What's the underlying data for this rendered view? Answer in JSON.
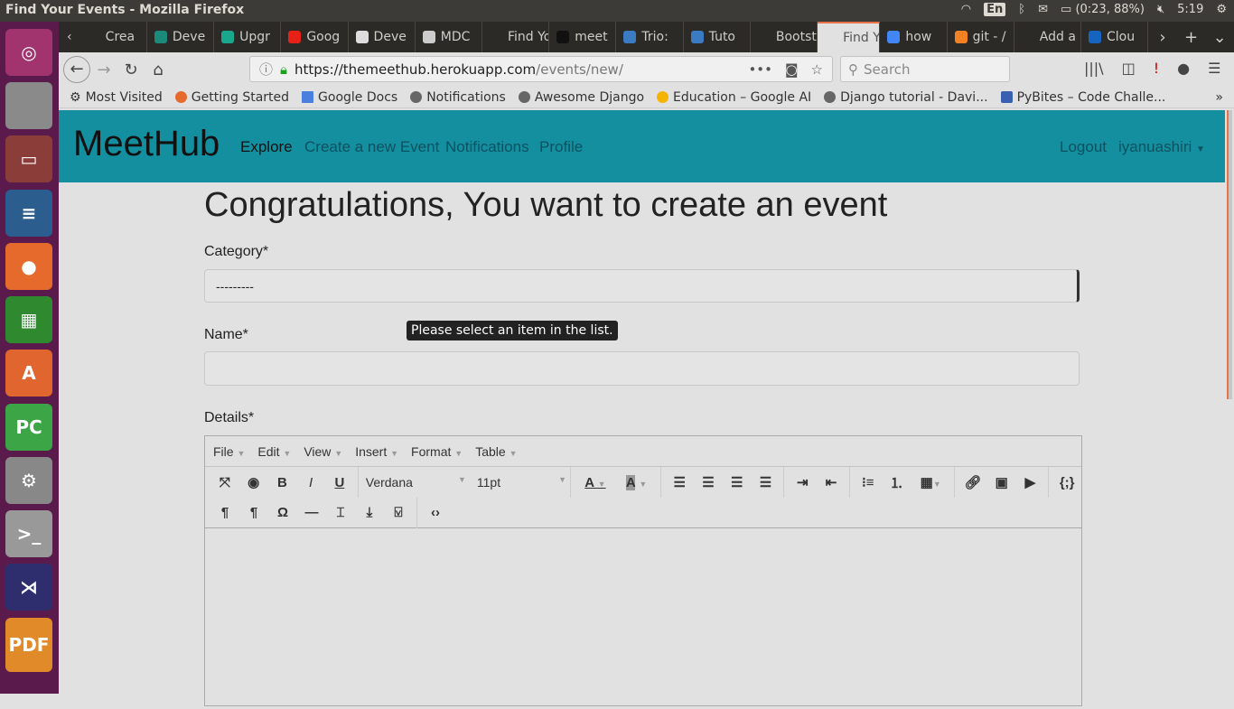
{
  "system": {
    "window_title": "Find Your Events - Mozilla Firefox",
    "keyboard": "En",
    "battery": "(0:23, 88%)",
    "time": "5:19"
  },
  "launcher": [
    "ubuntu-icon",
    "disk-backup-icon",
    "file-manager-icon",
    "writer-icon",
    "firefox-icon",
    "calc-icon",
    "software-center-icon",
    "pycharm-icon",
    "settings-icon",
    "terminal-icon",
    "vscode-icon",
    "pdf-icon"
  ],
  "tabs": [
    {
      "label": "Crea",
      "color": "#2b2a27"
    },
    {
      "label": "Deve",
      "color": "#1a8a7a"
    },
    {
      "label": "Upgr",
      "color": "#1aa88c"
    },
    {
      "label": "Goog",
      "color": "#e62117"
    },
    {
      "label": "Deve",
      "color": "#ddd"
    },
    {
      "label": "MDC",
      "color": "#ccc"
    },
    {
      "label": "Find You",
      "color": "#2b2a27"
    },
    {
      "label": "meet",
      "color": "#111"
    },
    {
      "label": "Trio:",
      "color": "#3b7bc4"
    },
    {
      "label": "Tuto",
      "color": "#3b7bc4"
    },
    {
      "label": "Bootstr",
      "color": "#2b2a27"
    },
    {
      "label": "Find Y",
      "color": "#e1e1e1",
      "active": true
    },
    {
      "label": "how",
      "color": "#4285f4"
    },
    {
      "label": "git - /",
      "color": "#f48024"
    },
    {
      "label": "Add a sc",
      "color": "#2b2a27"
    },
    {
      "label": "Clou",
      "color": "#1565c0"
    }
  ],
  "url": {
    "host": "https://themeethub.herokuapp.com",
    "path": "/events/new/"
  },
  "search_placeholder": "Search",
  "bookmarks": [
    "Most Visited",
    "Getting Started",
    "Google Docs",
    "Notifications",
    "Awesome Django",
    "Education – Google AI",
    "Django tutorial - Davi...",
    "PyBites – Code Challe..."
  ],
  "site": {
    "brand": "MeetHub",
    "nav": [
      "Explore",
      "Create a new Event",
      "Notifications",
      "Profile"
    ],
    "logout": "Logout",
    "user": "iyanuashiri"
  },
  "form": {
    "title": "Congratulations, You want to create an event",
    "category_label": "Category*",
    "category_value": "---------",
    "tooltip": "Please select an item in the list.",
    "name_label": "Name*",
    "name_value": "",
    "details_label": "Details*",
    "editor": {
      "menus": [
        "File",
        "Edit",
        "View",
        "Insert",
        "Format",
        "Table"
      ],
      "font": "Verdana",
      "size": "11pt"
    }
  },
  "colors": {
    "navbar": "#138fa0",
    "accent": "#e8734a"
  }
}
